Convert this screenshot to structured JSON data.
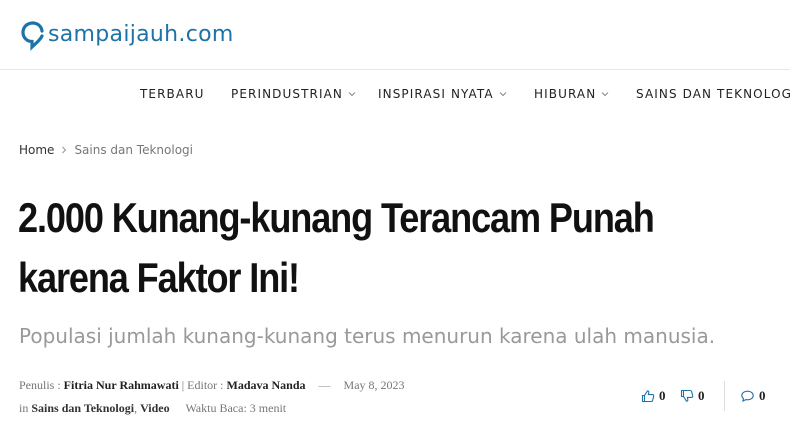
{
  "site": {
    "logo_text": "sampaijauh.com"
  },
  "nav": {
    "items": [
      {
        "label": "TERBARU"
      },
      {
        "label": "PERINDUSTRIAN"
      },
      {
        "label": "INSPIRASI NYATA"
      },
      {
        "label": "HIBURAN"
      },
      {
        "label": "SAINS DAN TEKNOLOGI"
      }
    ]
  },
  "breadcrumb": {
    "home": "Home",
    "category": "Sains dan Teknologi"
  },
  "article": {
    "title_line1": "2.000 Kunang-kunang Terancam Punah",
    "title_line2": "karena Faktor Ini!",
    "subtitle": "Populasi jumlah kunang-kunang terus menurun karena ulah manusia.",
    "meta": {
      "writer_label": "Penulis :",
      "writer": "Fitria Nur Rahmawati",
      "editor_label": "| Editor :",
      "editor": "Madava Nanda",
      "dash": "—",
      "date": "May 8, 2023",
      "in_label": "in",
      "category1": "Sains dan Teknologi",
      "comma": ",",
      "category2": "Video",
      "read_time": "Waktu Baca: 3 menit"
    },
    "reactions": {
      "likes": "0",
      "dislikes": "0",
      "comments": "0"
    }
  },
  "colors": {
    "brand": "#1d73a8",
    "action_icon": "#1d73a8"
  }
}
